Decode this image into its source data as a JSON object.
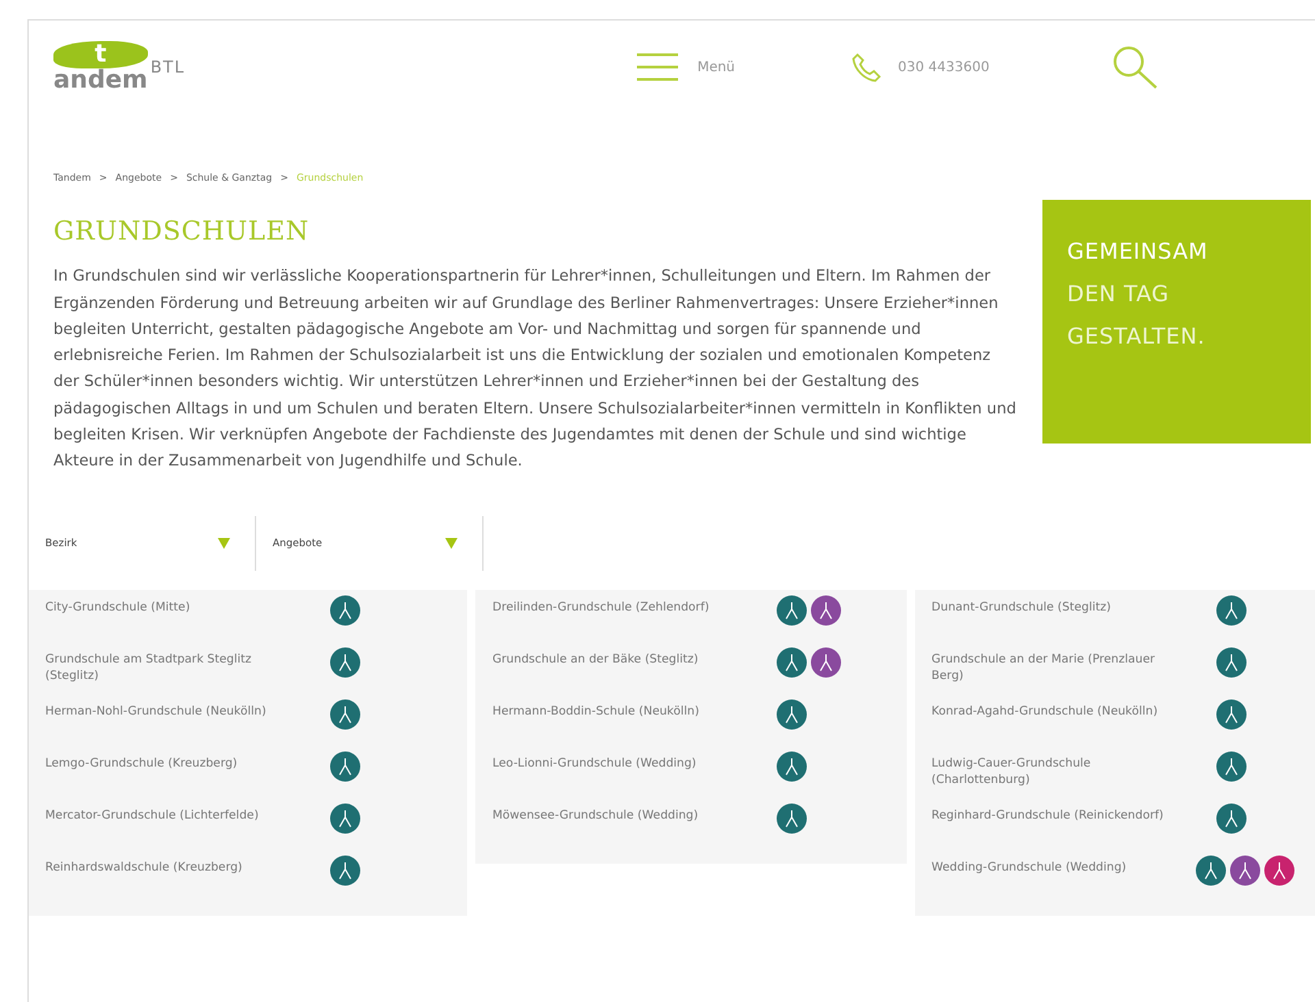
{
  "header": {
    "logo": {
      "main": "tandem",
      "suffix": "BTL"
    },
    "menu_label": "Menü",
    "phone": "030 4433600"
  },
  "breadcrumb": [
    {
      "label": "Tandem",
      "selected": false
    },
    {
      "separator": ">",
      "label": "Angebote",
      "selected": false
    },
    {
      "separator": ">",
      "label": "Schule & Ganztag",
      "selected": false
    },
    {
      "separator": ">",
      "label": "Grundschulen",
      "selected": true
    }
  ],
  "title": "GRUNDSCHULEN",
  "intro": "In Grundschulen sind wir verlässliche Kooperationspartnerin für Lehrer*innen, Schulleitungen und Eltern. Im Rahmen der Ergänzenden Förderung und Betreuung arbeiten wir auf Grundlage des Berliner Rahmenvertrages: Unsere Erzieher*innen begleiten Unterricht, gestalten pädagogische Angebote am Vor- und Nachmittag und sorgen für spannende und erlebnisreiche Ferien. Im Rahmen der Schulsozialarbeit ist uns die Entwicklung der sozialen und emotionalen Kompetenz der Schüler*innen besonders wichtig. Wir unterstützen Lehrer*innen und Erzieher*innen bei der Gestaltung des pädagogischen Alltags in und um Schulen und beraten Eltern. Unsere Schulsozialarbeiter*innen vermitteln in Konflikten und begleiten Krisen. Wir verknüpfen Angebote der Fachdienste des Jugendamtes mit denen der Schule und sind wichtige Akteure in der Zusammenarbeit von Jugendhilfe und Schule.",
  "slogan": [
    "GEMEINSAM",
    "DEN TAG",
    "GESTALTEN."
  ],
  "filters": [
    {
      "label": "Bezirk"
    },
    {
      "label": "Angebote"
    }
  ],
  "columns": [
    {
      "schools": [
        {
          "name": "City-Grundschule (Mitte)",
          "badges": [
            {
              "color": "#1f6f72"
            }
          ]
        },
        {
          "name": "Grundschule am Stadtpark Steglitz (Steglitz)",
          "badges": [
            {
              "color": "#1f6f72"
            }
          ]
        },
        {
          "name": "Herman-Nohl-Grundschule (Neukölln)",
          "badges": [
            {
              "color": "#1f6f72"
            }
          ]
        },
        {
          "name": "Lemgo-Grundschule (Kreuzberg)",
          "badges": [
            {
              "color": "#1f6f72"
            }
          ]
        },
        {
          "name": "Mercator-Grundschule (Lichterfelde)",
          "badges": [
            {
              "color": "#1f6f72"
            }
          ]
        },
        {
          "name": "Reinhardswaldschule (Kreuzberg)",
          "badges": [
            {
              "color": "#1f6f72"
            }
          ]
        }
      ]
    },
    {
      "schools": [
        {
          "name": "Dreilinden-Grundschule (Zehlendorf)",
          "badges": [
            {
              "color": "#1f6f72"
            },
            {
              "color": "#8a4a9e"
            }
          ]
        },
        {
          "name": "Grundschule an der Bäke (Steglitz)",
          "badges": [
            {
              "color": "#1f6f72"
            },
            {
              "color": "#8a4a9e"
            }
          ]
        },
        {
          "name": "Hermann-Boddin-Schule (Neukölln)",
          "badges": [
            {
              "color": "#1f6f72"
            }
          ]
        },
        {
          "name": "Leo-Lionni-Grundschule (Wedding)",
          "badges": [
            {
              "color": "#1f6f72"
            }
          ]
        },
        {
          "name": "Möwensee-Grundschule (Wedding)",
          "badges": [
            {
              "color": "#1f6f72"
            }
          ]
        }
      ]
    },
    {
      "schools": [
        {
          "name": "Dunant-Grundschule (Steglitz)",
          "badges": [
            {
              "color": "#1f6f72"
            }
          ]
        },
        {
          "name": "Grundschule an der Marie (Prenzlauer Berg)",
          "badges": [
            {
              "color": "#1f6f72"
            }
          ]
        },
        {
          "name": "Konrad-Agahd-Grundschule (Neukölln)",
          "badges": [
            {
              "color": "#1f6f72"
            }
          ]
        },
        {
          "name": "Ludwig-Cauer-Grundschule (Charlottenburg)",
          "badges": [
            {
              "color": "#1f6f72"
            }
          ]
        },
        {
          "name": "Reginhard-Grundschule (Reinickendorf)",
          "badges": [
            {
              "color": "#1f6f72"
            }
          ]
        },
        {
          "name": "Wedding-Grundschule (Wedding)",
          "badges": [
            {
              "color": "#1f6f72"
            },
            {
              "color": "#8a4a9e"
            },
            {
              "color": "#c8236e"
            }
          ]
        }
      ]
    }
  ]
}
